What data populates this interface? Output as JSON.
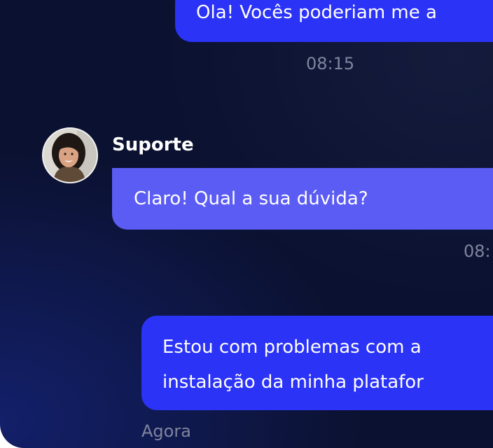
{
  "chat": {
    "messages": [
      {
        "sender": "user",
        "lines": [
          "Ola! Vocês poderiam me a"
        ],
        "time": "08:15"
      },
      {
        "sender": "support",
        "sender_name": "Suporte",
        "lines": [
          "Claro! Qual a sua dúvida?"
        ],
        "time": "08:"
      },
      {
        "sender": "user",
        "lines": [
          "Estou com problemas com a",
          "instalação da minha platafor"
        ],
        "time": "Agora"
      }
    ]
  },
  "colors": {
    "background": "#0b1130",
    "user_bubble": "#2b33f7",
    "support_bubble": "#5b5cf4",
    "timestamp": "#7f859d"
  },
  "icons": {
    "avatar": "support-agent-avatar"
  }
}
